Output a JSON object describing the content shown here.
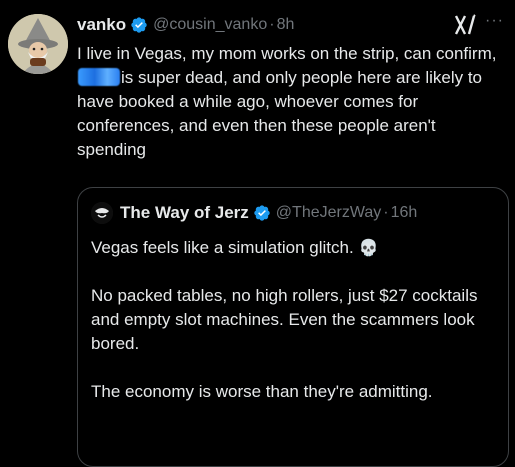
{
  "tweet": {
    "author_name": "vanko",
    "handle": "@cousin_vanko",
    "separator": "·",
    "time": "8h",
    "text_before_redaction": "I live in Vegas, my mom works on the strip, can confirm, ",
    "text_after_redaction": "is super dead, and only people here are likely to have booked a while ago, whoever comes for conferences, and even then these people aren't spending",
    "verified_color": "#1d9bf0",
    "grok_icon": "grok-icon",
    "more_icon": "more-options-icon",
    "more_glyph": "···"
  },
  "quote": {
    "author_name": "The Way of Jerz",
    "handle": "@TheJerzWay",
    "separator": "·",
    "time": "16h",
    "paragraph_1": "Vegas feels like a simulation glitch.",
    "paragraph_1_emoji": "💀",
    "paragraph_2": "No packed tables, no high rollers, just $27 cocktails and empty slot machines. Even the scammers look bored.",
    "paragraph_3": "The economy is worse than they're admitting."
  }
}
